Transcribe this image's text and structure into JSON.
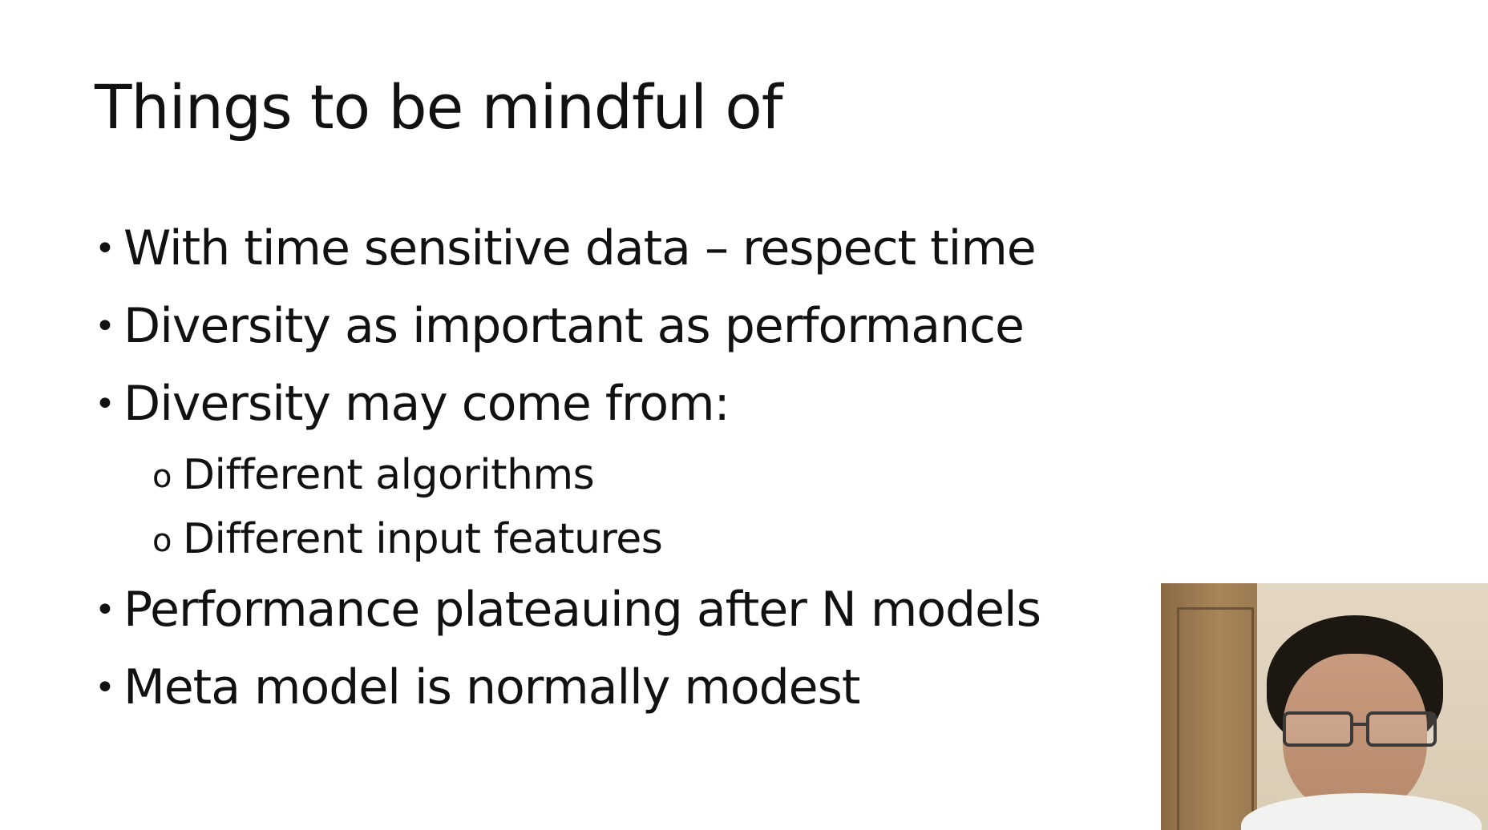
{
  "slide": {
    "title": "Things to be mindful of",
    "bullet_marker": "•",
    "sub_bullet_marker": "o",
    "bullets": [
      "With time sensitive data – respect time",
      "Diversity as important as performance",
      "Diversity may come from:"
    ],
    "sub_bullets": [
      "Different algorithms",
      "Different input features"
    ],
    "bullets_after": [
      "Performance plateauing after N models",
      "Meta model is normally modest"
    ]
  }
}
